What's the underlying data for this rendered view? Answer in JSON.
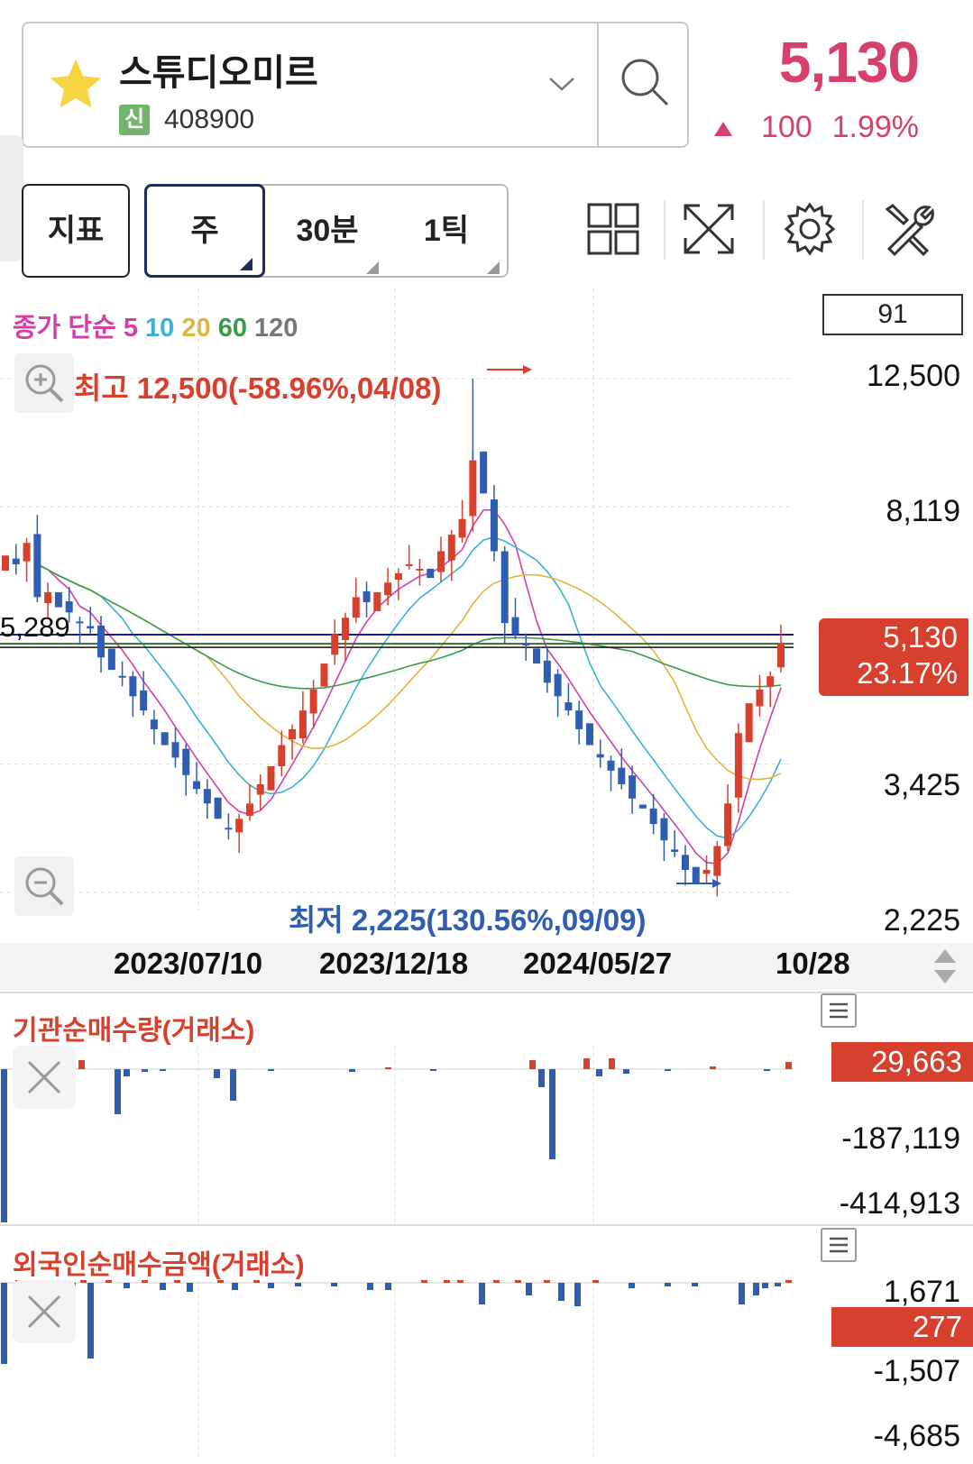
{
  "header": {
    "stock_name": "스튜디오미르",
    "badge": "신",
    "stock_code": "408900",
    "price": "5,130",
    "change": "100",
    "change_rate": "1.99%",
    "accent_color": "#d6416b"
  },
  "toolbar": {
    "indicator_label": "지표",
    "periods": [
      "주",
      "30분",
      "1틱"
    ],
    "selected_period": "주",
    "icons": [
      "layout-grid-icon",
      "expand-icon",
      "gear-icon",
      "tools-icon"
    ]
  },
  "main_chart": {
    "legend": {
      "prefix": "종가 단순",
      "periods": [
        "5",
        "10",
        "20",
        "60",
        "120"
      ],
      "colors": [
        "#d43fa6",
        "#39b2d8",
        "#e0b63a",
        "#3a9b4a",
        "#777777"
      ]
    },
    "count": "91",
    "high_label": "최고 12,500(-58.96%,04/08)",
    "low_label": "최저 2,225(130.56%,09/09)",
    "ref_price": "5,289",
    "current_price": "5,130",
    "current_rate": "23.17%",
    "y_ticks": [
      "12,500",
      "8,119",
      "3,425",
      "2,225"
    ],
    "x_ticks": [
      "2023/07/10",
      "2023/12/18",
      "2024/05/27",
      "10/28"
    ]
  },
  "panel_institution": {
    "title": "기관순매수량(거래소)",
    "current": "29,663",
    "ticks": [
      "-187,119",
      "-414,913"
    ]
  },
  "panel_foreign": {
    "title": "외국인순매수금액(거래소)",
    "current": "277",
    "ticks": [
      "1,671",
      "-1,507",
      "-4,685"
    ]
  },
  "chart_data": {
    "type": "candlestick",
    "title": "",
    "period": "weekly",
    "y_range": [
      2225,
      12500
    ],
    "x_ticks": [
      "2023/07/10",
      "2023/12/18",
      "2024/05/27",
      "10/28"
    ],
    "closes": [
      6900,
      6700,
      7200,
      6000,
      6100,
      5800,
      5700,
      5500,
      5400,
      4900,
      4700,
      4600,
      4300,
      4100,
      3850,
      3650,
      3500,
      3300,
      3150,
      3000,
      2850,
      2750,
      2850,
      3000,
      3200,
      3400,
      3650,
      3850,
      4100,
      4400,
      4800,
      5300,
      5600,
      6000,
      5900,
      6100,
      6300,
      6500,
      6700,
      6600,
      6400,
      7000,
      7400,
      7800,
      9500,
      8500,
      7000,
      5500,
      5300,
      5100,
      4800,
      4500,
      4300,
      4100,
      3850,
      3650,
      3500,
      3350,
      3200,
      3050,
      2950,
      2800,
      2650,
      2550,
      2400,
      2300,
      2400,
      2600,
      3000,
      3800,
      4200,
      4400,
      4600,
      5130
    ],
    "high": {
      "value": 12500,
      "date": "04/08"
    },
    "low": {
      "value": 2225,
      "date": "09/09"
    },
    "last": {
      "value": 5130,
      "rate": "23.17%"
    }
  }
}
